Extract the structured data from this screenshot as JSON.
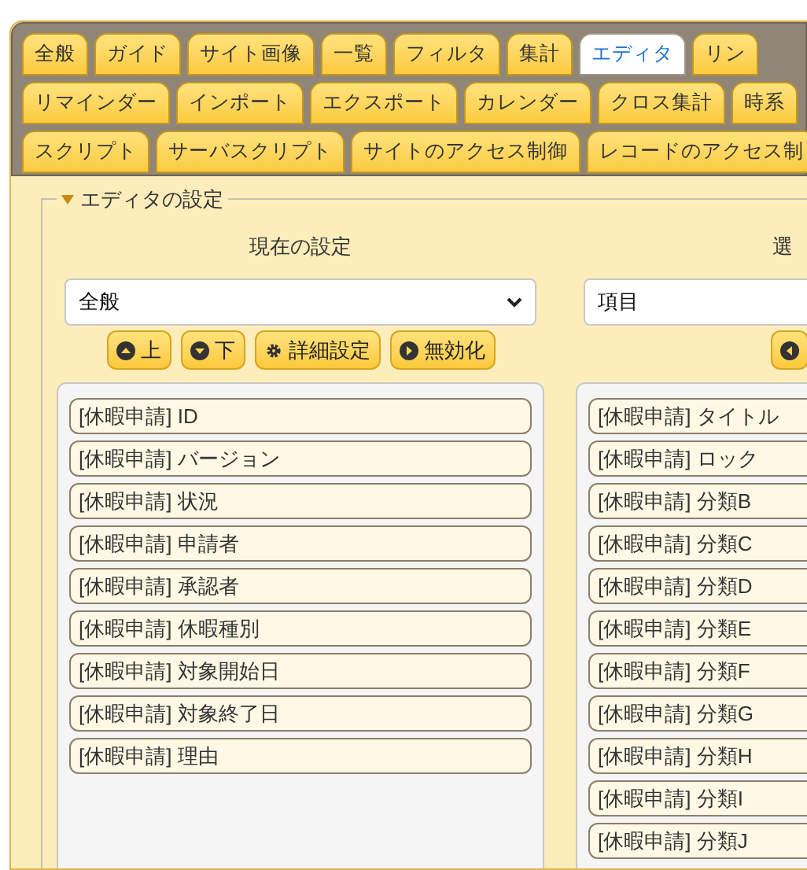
{
  "tab_rows": [
    [
      {
        "label": "全般",
        "selected": false
      },
      {
        "label": "ガイド",
        "selected": false
      },
      {
        "label": "サイト画像",
        "selected": false
      },
      {
        "label": "一覧",
        "selected": false
      },
      {
        "label": "フィルタ",
        "selected": false
      },
      {
        "label": "集計",
        "selected": false
      },
      {
        "label": "エディタ",
        "selected": true
      },
      {
        "label": "リン",
        "selected": false
      }
    ],
    [
      {
        "label": "リマインダー",
        "selected": false
      },
      {
        "label": "インポート",
        "selected": false
      },
      {
        "label": "エクスポート",
        "selected": false
      },
      {
        "label": "カレンダー",
        "selected": false
      },
      {
        "label": "クロス集計",
        "selected": false
      },
      {
        "label": "時系",
        "selected": false
      }
    ],
    [
      {
        "label": "スクリプト",
        "selected": false
      },
      {
        "label": "サーバスクリプト",
        "selected": false
      },
      {
        "label": "サイトのアクセス制御",
        "selected": false
      },
      {
        "label": "レコードのアクセス制",
        "selected": false
      }
    ]
  ],
  "section": {
    "legend": "エディタの設定",
    "expanded": true
  },
  "columns": [
    {
      "header": "現在の設定",
      "select": "全般",
      "buttons": [
        {
          "kind": "up",
          "label": "上"
        },
        {
          "kind": "down",
          "label": "下"
        },
        {
          "kind": "gear",
          "label": "詳細設定"
        },
        {
          "kind": "right",
          "label": "無効化"
        }
      ],
      "items": [
        "[休暇申請] ID",
        "[休暇申請] バージョン",
        "[休暇申請] 状況",
        "[休暇申請] 申請者",
        "[休暇申請] 承認者",
        "[休暇申請] 休暇種別",
        "[休暇申請] 対象開始日",
        "[休暇申請] 対象終了日",
        "[休暇申請] 理由"
      ]
    },
    {
      "header": "選",
      "select": "項目",
      "buttons": [
        {
          "kind": "left"
        }
      ],
      "items": [
        "[休暇申請] タイトル",
        "[休暇申請] ロック",
        "[休暇申請] 分類B",
        "[休暇申請] 分類C",
        "[休暇申請] 分類D",
        "[休暇申請] 分類E",
        "[休暇申請] 分類F",
        "[休暇申請] 分類G",
        "[休暇申請] 分類H",
        "[休暇申請] 分類I",
        "[休暇申請] 分類J"
      ]
    }
  ]
}
